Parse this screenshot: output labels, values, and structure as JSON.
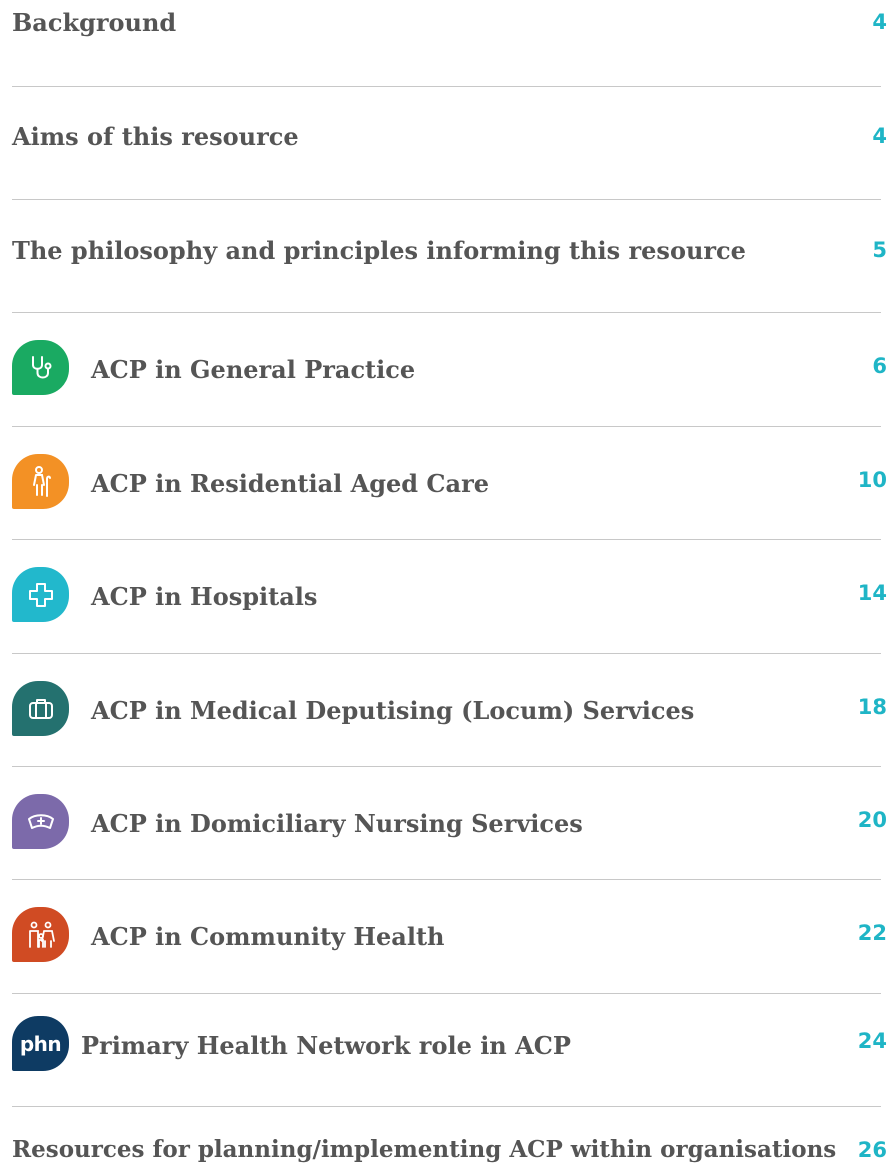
{
  "entries": [
    {
      "title": "Background",
      "page": "4"
    },
    {
      "title": "Aims of this resource",
      "page": "4"
    },
    {
      "title": "The philosophy and principles informing this resource",
      "page": "5"
    },
    {
      "title": "ACP in General Practice",
      "page": "6",
      "icon": "stethoscope-icon",
      "color": "#1aaa62"
    },
    {
      "title": "ACP in Residential Aged Care",
      "page": "10",
      "icon": "elderly-person-icon",
      "color": "#f39125"
    },
    {
      "title": "ACP in Hospitals",
      "page": "14",
      "icon": "medical-cross-icon",
      "color": "#22b8cc"
    },
    {
      "title": "ACP in Medical Deputising (Locum) Services",
      "page": "18",
      "icon": "medical-bag-icon",
      "color": "#24716f"
    },
    {
      "title": "ACP in Domiciliary Nursing Services",
      "page": "20",
      "icon": "nurse-cap-icon",
      "color": "#7c6aaa"
    },
    {
      "title": "ACP in Community Health",
      "page": "22",
      "icon": "people-group-icon",
      "color": "#d04b23"
    },
    {
      "title": "Primary Health Network role in ACP",
      "page": "24",
      "icon": "phn-logo",
      "icon_text": "phn",
      "color": "#0e3b63"
    },
    {
      "title": "Resources for planning/implementing ACP within organisations",
      "page": "26"
    }
  ],
  "colors": {
    "title": "#555555",
    "page_number": "#1fb5c6",
    "divider": "#c8c8c8"
  }
}
